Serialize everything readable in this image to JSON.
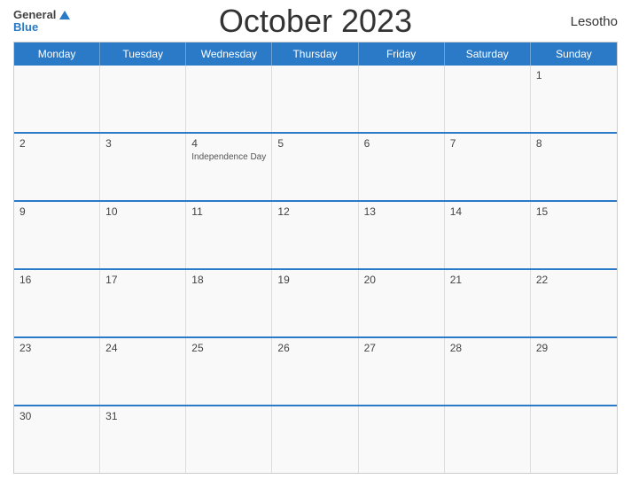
{
  "header": {
    "title": "October 2023",
    "country": "Lesotho",
    "logo_general": "General",
    "logo_blue": "Blue"
  },
  "days": {
    "headers": [
      "Monday",
      "Tuesday",
      "Wednesday",
      "Thursday",
      "Friday",
      "Saturday",
      "Sunday"
    ]
  },
  "weeks": [
    {
      "cells": [
        {
          "number": "",
          "event": ""
        },
        {
          "number": "",
          "event": ""
        },
        {
          "number": "",
          "event": ""
        },
        {
          "number": "",
          "event": ""
        },
        {
          "number": "",
          "event": ""
        },
        {
          "number": "",
          "event": ""
        },
        {
          "number": "1",
          "event": ""
        }
      ]
    },
    {
      "cells": [
        {
          "number": "2",
          "event": ""
        },
        {
          "number": "3",
          "event": ""
        },
        {
          "number": "4",
          "event": "Independence Day"
        },
        {
          "number": "5",
          "event": ""
        },
        {
          "number": "6",
          "event": ""
        },
        {
          "number": "7",
          "event": ""
        },
        {
          "number": "8",
          "event": ""
        }
      ]
    },
    {
      "cells": [
        {
          "number": "9",
          "event": ""
        },
        {
          "number": "10",
          "event": ""
        },
        {
          "number": "11",
          "event": ""
        },
        {
          "number": "12",
          "event": ""
        },
        {
          "number": "13",
          "event": ""
        },
        {
          "number": "14",
          "event": ""
        },
        {
          "number": "15",
          "event": ""
        }
      ]
    },
    {
      "cells": [
        {
          "number": "16",
          "event": ""
        },
        {
          "number": "17",
          "event": ""
        },
        {
          "number": "18",
          "event": ""
        },
        {
          "number": "19",
          "event": ""
        },
        {
          "number": "20",
          "event": ""
        },
        {
          "number": "21",
          "event": ""
        },
        {
          "number": "22",
          "event": ""
        }
      ]
    },
    {
      "cells": [
        {
          "number": "23",
          "event": ""
        },
        {
          "number": "24",
          "event": ""
        },
        {
          "number": "25",
          "event": ""
        },
        {
          "number": "26",
          "event": ""
        },
        {
          "number": "27",
          "event": ""
        },
        {
          "number": "28",
          "event": ""
        },
        {
          "number": "29",
          "event": ""
        }
      ]
    },
    {
      "cells": [
        {
          "number": "30",
          "event": ""
        },
        {
          "number": "31",
          "event": ""
        },
        {
          "number": "",
          "event": ""
        },
        {
          "number": "",
          "event": ""
        },
        {
          "number": "",
          "event": ""
        },
        {
          "number": "",
          "event": ""
        },
        {
          "number": "",
          "event": ""
        }
      ]
    }
  ]
}
